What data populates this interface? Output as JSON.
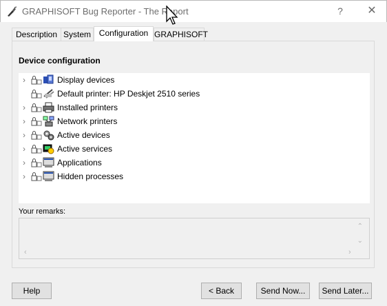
{
  "window": {
    "title": "GRAPHISOFT Bug Reporter - The Report",
    "help_glyph": "?",
    "close_glyph": "✕"
  },
  "tabs": [
    {
      "label": "Description",
      "active": false
    },
    {
      "label": "System",
      "active": false
    },
    {
      "label": "Configuration",
      "active": true
    },
    {
      "label": "GRAPHISOFT",
      "active": false
    }
  ],
  "configuration": {
    "section_title": "Device configuration",
    "tree": [
      {
        "label": "Display devices",
        "expandable": true,
        "icon": "display-devices-icon"
      },
      {
        "label": "Default printer: HP Deskjet 2510 series",
        "expandable": false,
        "icon": "printer-icon"
      },
      {
        "label": "Installed printers",
        "expandable": true,
        "icon": "printer-icon"
      },
      {
        "label": "Network printers",
        "expandable": true,
        "icon": "network-printer-icon"
      },
      {
        "label": "Active devices",
        "expandable": true,
        "icon": "devices-icon"
      },
      {
        "label": "Active services",
        "expandable": true,
        "icon": "services-icon"
      },
      {
        "label": "Applications",
        "expandable": true,
        "icon": "application-icon"
      },
      {
        "label": "Hidden processes",
        "expandable": true,
        "icon": "application-icon"
      }
    ],
    "remarks_label": "Your remarks:",
    "remarks_value": ""
  },
  "buttons": {
    "help": "Help",
    "back": "< Back",
    "send_now": "Send Now...",
    "send_later": "Send Later..."
  }
}
